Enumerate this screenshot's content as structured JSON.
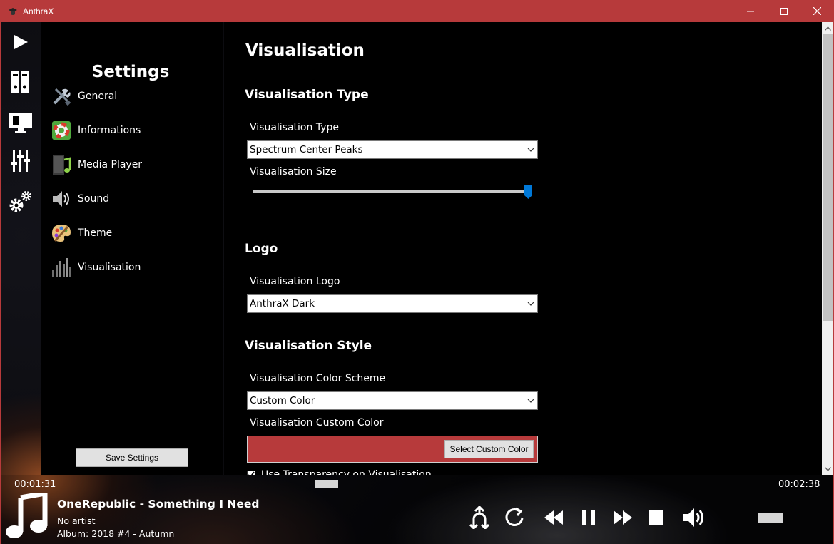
{
  "window": {
    "title": "AnthraX"
  },
  "sidebar": {
    "items": [
      {
        "name": "play-icon"
      },
      {
        "name": "library-icon"
      },
      {
        "name": "monitor-icon"
      },
      {
        "name": "equalizer-icon"
      },
      {
        "name": "settings-icon"
      }
    ]
  },
  "nav": {
    "title": "Settings",
    "items": [
      {
        "label": "General",
        "icon": "tools-icon"
      },
      {
        "label": "Informations",
        "icon": "lifebuoy-icon"
      },
      {
        "label": "Media Player",
        "icon": "media-player-icon"
      },
      {
        "label": "Sound",
        "icon": "speaker-icon"
      },
      {
        "label": "Theme",
        "icon": "palette-icon"
      },
      {
        "label": "Visualisation",
        "icon": "bars-icon"
      }
    ],
    "save_label": "Save Settings"
  },
  "content": {
    "title": "Visualisation",
    "section_type": {
      "heading": "Visualisation Type",
      "type_label": "Visualisation Type",
      "type_value": "Spectrum Center Peaks",
      "size_label": "Visualisation Size",
      "size_value": 1.0
    },
    "section_logo": {
      "heading": "Logo",
      "logo_label": "Visualisation Logo",
      "logo_value": "AnthraX Dark"
    },
    "section_style": {
      "heading": "Visualisation Style",
      "scheme_label": "Visualisation Color Scheme",
      "scheme_value": "Custom Color",
      "custom_color_label": "Visualisation Custom Color",
      "custom_color": "#b73a3b",
      "select_color_label": "Select Custom Color",
      "transparency_label": "Use Transparency on Visualisation",
      "transparency_checked": true
    }
  },
  "player": {
    "elapsed": "00:01:31",
    "duration": "00:02:38",
    "progress": 0.58,
    "track_title": "OneRepublic - Something I Need",
    "artist": "No artist",
    "album": "Album: 2018 #4 - Autumn",
    "volume": 0.9
  },
  "colors": {
    "accent": "#b73a3b",
    "slider_thumb": "#0078d7"
  }
}
